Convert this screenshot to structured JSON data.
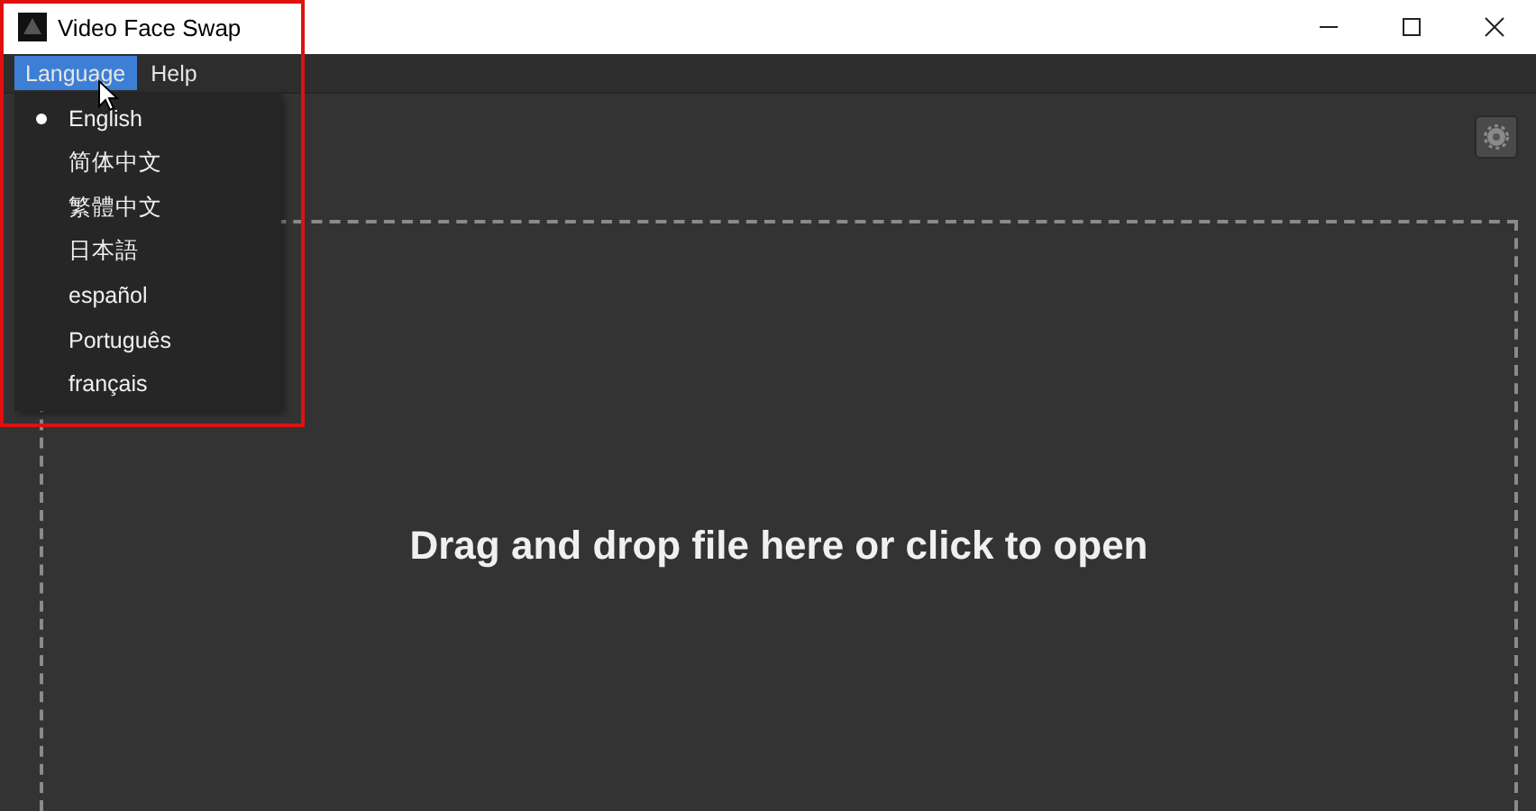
{
  "window": {
    "title": "Video Face Swap"
  },
  "menu_bar": [
    {
      "label": "Language",
      "selected": true
    },
    {
      "label": "Help",
      "selected": false
    }
  ],
  "language_menu": [
    {
      "label": "English",
      "selected": true
    },
    {
      "label": "简体中文",
      "selected": false
    },
    {
      "label": "繁體中文",
      "selected": false
    },
    {
      "label": "日本語",
      "selected": false
    },
    {
      "label": "español",
      "selected": false
    },
    {
      "label": "Português",
      "selected": false
    },
    {
      "label": "français",
      "selected": false
    }
  ],
  "drop_zone": {
    "text": "Drag and drop file here or click to open"
  }
}
